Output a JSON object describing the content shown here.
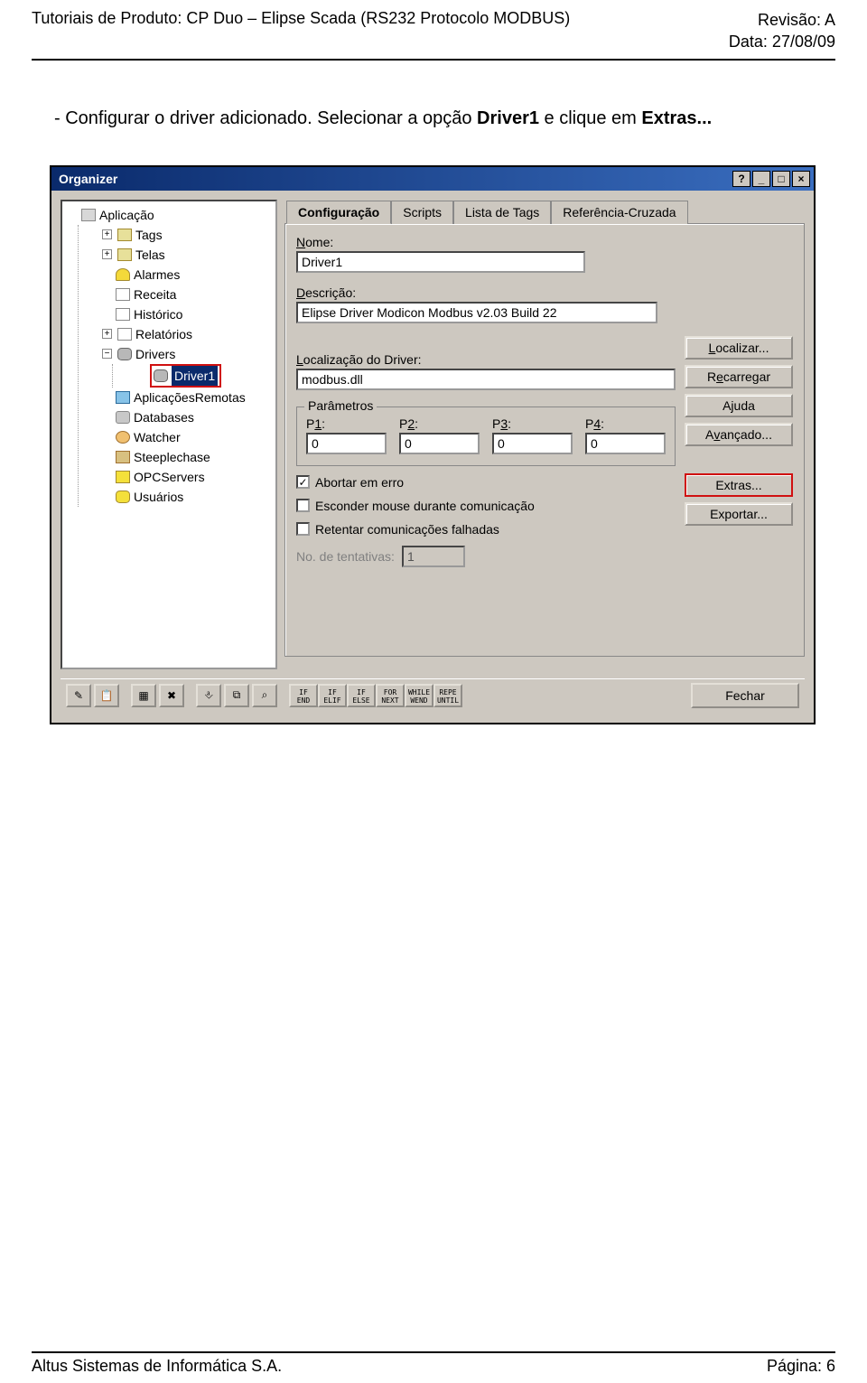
{
  "doc": {
    "header_left": "Tutoriais de Produto: CP Duo – Elipse Scada (RS232 Protocolo MODBUS)",
    "header_right_rev": "Revisão: A",
    "header_right_date": "Data: 27/08/09",
    "footer_left": "Altus Sistemas de Informática S.A.",
    "footer_right": "Página: 6",
    "paragraph_prefix": "-   Configurar o driver adicionado. Selecionar a opção ",
    "paragraph_driver": "Driver1",
    "paragraph_mid": " e clique em ",
    "paragraph_extras": "Extras...",
    "paragraph_suffix": ""
  },
  "win": {
    "title": "Organizer",
    "btn_help": "?",
    "btn_min": "_",
    "btn_max": "□",
    "btn_close": "×"
  },
  "tree": {
    "root": "Aplicação",
    "items": [
      "Tags",
      "Telas",
      "Alarmes",
      "Receita",
      "Histórico",
      "Relatórios"
    ],
    "drivers": "Drivers",
    "driver1": "Driver1",
    "after": [
      "AplicaçõesRemotas",
      "Databases",
      "Watcher",
      "Steeplechase",
      "OPCServers",
      "Usuários"
    ]
  },
  "tabs": {
    "config": "Configuração",
    "scripts": "Scripts",
    "tags": "Lista de Tags",
    "ref": "Referência-Cruzada"
  },
  "panel": {
    "name_label": "Nome:",
    "name_value": "Driver1",
    "desc_label": "Descrição:",
    "desc_value": "Elipse Driver Modicon Modbus v2.03 Build 22",
    "loc_label": "Localização do Driver:",
    "loc_value": "modbus.dll",
    "params_legend": "Parâmetros",
    "p1_label": "P1:",
    "p2_label": "P2:",
    "p3_label": "P3:",
    "p4_label": "P4:",
    "p1": "0",
    "p2": "0",
    "p3": "0",
    "p4": "0",
    "chk_abort": "Abortar em erro",
    "chk_hide": "Esconder mouse durante comunicação",
    "chk_retry": "Retentar comunicações falhadas",
    "tentativas_label": "No. de tentativas:",
    "tentativas_value": "1"
  },
  "buttons": {
    "localizar": "Localizar...",
    "recarregar": "Recarregar",
    "ajuda": "Ajuda",
    "avancado": "Avançado...",
    "extras": "Extras...",
    "exportar": "Exportar...",
    "fechar": "Fechar"
  },
  "toolbar": {
    "b1": "✎",
    "b2": "📋",
    "b3": "▦",
    "b4": "✖",
    "b5": "⎀",
    "b6": "⧉",
    "b7": "⌕",
    "t1": "IF\nEND",
    "t2": "IF\nELIF",
    "t3": "IF\nELSE",
    "t4": "FOR\nNEXT",
    "t5": "WHILE\nWEND",
    "t6": "REPE\nUNTIL"
  }
}
